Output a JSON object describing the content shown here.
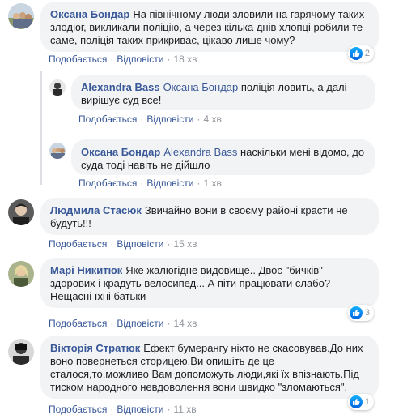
{
  "action_labels": {
    "like": "Подобається",
    "reply": "Відповісти"
  },
  "comments": [
    {
      "author": "Оксана Бондар",
      "text": "На північному люди зловили на гарячому таких злодюг, викликали поліцію, а через кілька днів хлопці робили те саме, поліція таких прикриває, цікаво лише чому?",
      "time": "18 хв",
      "reactions": "2",
      "replies": [
        {
          "author": "Alexandra Bass",
          "mention": "Оксана Бондар",
          "text": "поліція ловить, а далі- вирішує суд все!",
          "time": "4 хв"
        },
        {
          "author": "Оксана Бондар",
          "mention": "Alexandra Bass",
          "text": "наскільки мені відомо, до суда тоді навіть не дійшло",
          "time": "1 хв"
        }
      ]
    },
    {
      "author": "Людмила Стасюк",
      "text": "Звичайно вони в своєму районі красти не будуть!!!",
      "time": "15 хв"
    },
    {
      "author": "Марі Никитюк",
      "text": "Яке жалюгідне видовище.. Двоє \"бичків\" здорових і крадуть велосипед... А піти працювати слабо? Нещасні їхні батьки",
      "time": "14 хв",
      "reactions": "3"
    },
    {
      "author": "Вікторія Стратюк",
      "text": "Ефект бумерангу ніхто не скасовував.До них воно повернеться сторицею.Ви опишіть де це сталося,то,можливо Вам допоможуть люди,які їх впізнають.Під тиском народного невдоволення вони швидко \"зломаються\".",
      "time": "11 хв",
      "reactions": "1"
    }
  ],
  "colors": {
    "link": "#385898",
    "bubble": "#f2f3f5",
    "meta": "#90949c",
    "like": "#1877f2"
  }
}
